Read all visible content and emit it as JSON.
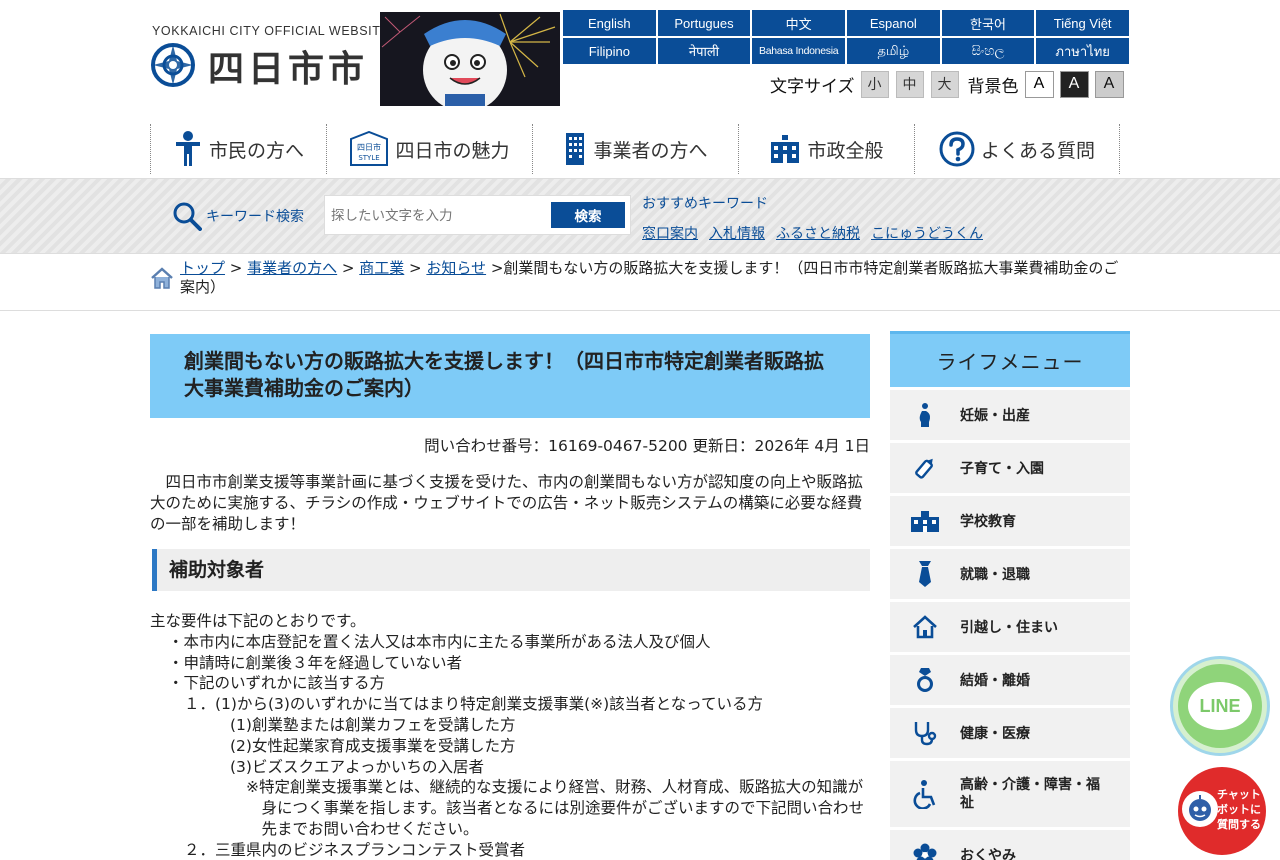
{
  "header": {
    "logo_en": "YOKKAICHI CITY OFFICIAL WEBSITE",
    "logo_ja": "四日市市",
    "languages": [
      "English",
      "Portugues",
      "中文",
      "Espanol",
      "한국어",
      "Tiếng Việt",
      "Filipino",
      "नेपाली",
      "Bahasa Indonesia",
      "தமிழ்",
      "සිංහල",
      "ภาษาไทย"
    ],
    "font_size_label": "文字サイズ",
    "font_sizes": [
      "小",
      "中",
      "大"
    ],
    "bg_label": "背景色",
    "bg_options": [
      "A",
      "A",
      "A"
    ]
  },
  "nav": {
    "items": [
      "市民の方へ",
      "四日市の魅力",
      "事業者の方へ",
      "市政全般",
      "よくある質問"
    ],
    "style_badge_top": "四日市",
    "style_badge_bottom": "STYLE"
  },
  "search": {
    "label": "キーワード検索",
    "placeholder": "探したい文字を入力",
    "button": "検索",
    "rec_title": "おすすめキーワード",
    "rec_links": [
      "窓口案内",
      "入札情報",
      "ふるさと納税",
      "こにゅうどうくん"
    ]
  },
  "breadcrumb": {
    "links": [
      "トップ",
      "事業者の方へ",
      "商工業",
      "お知らせ"
    ],
    "current": "創業間もない方の販路拡大を支援します！（四日市市特定創業者販路拡大事業費補助金のご案内）"
  },
  "article": {
    "title": "創業間もない方の販路拡大を支援します！（四日市市特定創業者販路拡大事業費補助金のご案内）",
    "meta": "問い合わせ番号：16169-0467-5200 更新日：2026年 4月 1日",
    "lead": "四日市市創業支援等事業計画に基づく支援を受けた、市内の創業間もない方が認知度の向上や販路拡大のために実施する、チラシの作成・ウェブサイトでの広告・ネット販売システムの構築に必要な経費の一部を補助します！",
    "h2": "補助対象者",
    "intro": "主な要件は下記のとおりです。",
    "req1": "・本市内に本店登記を置く法人又は本市内に主たる事業所がある法人及び個人",
    "req2": "・申請時に創業後３年を経過していない者",
    "req3": "・下記のいずれかに該当する方",
    "sub1": "１．(1)から(3)のいずれかに当てはまり特定創業支援事業(※)該当者となっている方",
    "sub1a": "(1)創業塾または創業カフェを受講した方",
    "sub1b": "(2)女性起業家育成支援事業を受講した方",
    "sub1c": "(3)ビズスクエアよっかいちの入居者",
    "note": "※特定創業支援事業とは、継続的な支援により経営、財務、人材育成、販路拡大の知識が身につく事業を指します。該当者となるには別途要件がございますので下記問い合わせ先までお問い合わせください。",
    "sub2": "２．三重県内のビジネスプランコンテスト受賞者"
  },
  "life_menu": {
    "title": "ライフメニュー",
    "items": [
      "妊娠・出産",
      "子育て・入園",
      "学校教育",
      "就職・退職",
      "引越し・住まい",
      "結婚・離婚",
      "健康・医療",
      "高齢・介護・障害・福祉",
      "おくやみ"
    ]
  },
  "floating": {
    "line": "LINE",
    "chat": [
      "チャット",
      "ボットに",
      "質問する"
    ]
  },
  "colors": {
    "primary": "#0a4d97",
    "title_bg": "#7ecbf7",
    "heading_bar": "#2c78c4",
    "chat_red": "#e02b2b",
    "line_green": "#8fd47a"
  }
}
